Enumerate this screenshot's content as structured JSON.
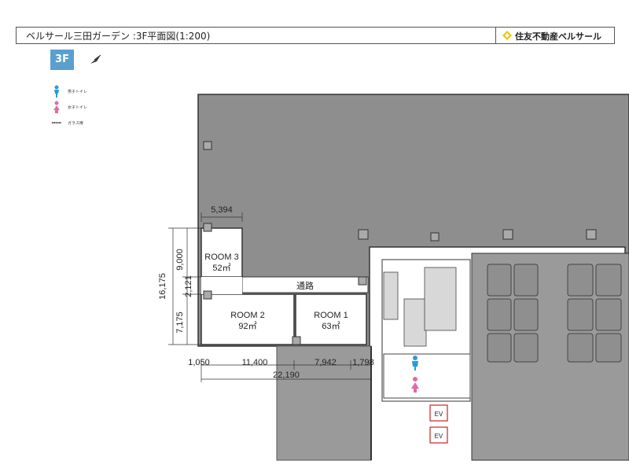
{
  "header": {
    "title": "ベルサール三田ガーデン :3F平面図(1:200)",
    "brand": "住友不動産ベルサール"
  },
  "floor_label": "3F",
  "legend": [
    {
      "icon": "male-toilet-icon",
      "label": "男子トイレ",
      "color": "#2a9bd6"
    },
    {
      "icon": "female-toilet-icon",
      "label": "女子トイレ",
      "color": "#e06aa8"
    },
    {
      "icon": "glass-door-icon",
      "label": "ガラス扉",
      "color": "#444444"
    }
  ],
  "rooms": [
    {
      "name": "ROOM 3",
      "area": "52㎡"
    },
    {
      "name": "ROOM 2",
      "area": "92㎡"
    },
    {
      "name": "ROOM 1",
      "area": "63㎡"
    }
  ],
  "corridor_label": "通路",
  "dimensions": {
    "top_width": "5,394",
    "vertical_total": "16,175",
    "vertical_room3": "9,000",
    "vertical_corridor": "2,121",
    "vertical_rooms12": "7,175",
    "bottom_a": "1,050",
    "bottom_b": "11,400",
    "bottom_c": "7,942",
    "bottom_d": "1,798",
    "bottom_total": "22,190"
  },
  "elevators": [
    "EV",
    "EV"
  ],
  "colors": {
    "floor_gray": "#8e8e8e",
    "room_gray": "#cfcfcf",
    "wall": "#333333",
    "badge": "#5b9fcf",
    "brand_yellow": "#f2c300",
    "ev_red": "#cc2222"
  }
}
